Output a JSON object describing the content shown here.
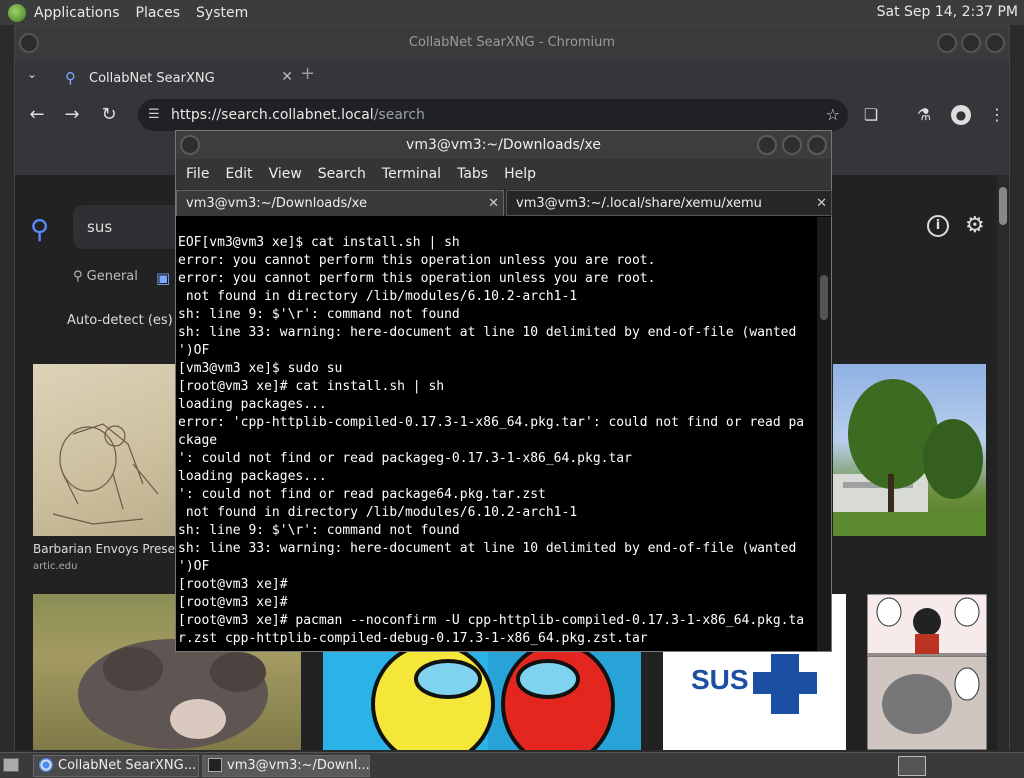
{
  "panel": {
    "menus": [
      "Applications",
      "Places",
      "System"
    ],
    "clock": "Sat Sep 14,  2:37 PM"
  },
  "chromium": {
    "title": "CollabNet SearXNG - Chromium",
    "tab_label": "CollabNet SearXNG",
    "url_host": "https://search.collabnet.local",
    "url_path": "/search",
    "search_query": "sus",
    "categories": {
      "general": "General"
    },
    "language": "Auto-detect (es)",
    "results": [
      {
        "caption": "Barbarian Envoys Prese",
        "source": "artic.edu"
      }
    ],
    "result_sus_text": "SUS"
  },
  "terminal": {
    "title": "vm3@vm3:~/Downloads/xe",
    "menus": [
      "File",
      "Edit",
      "View",
      "Search",
      "Terminal",
      "Tabs",
      "Help"
    ],
    "tabs": [
      {
        "label": "vm3@vm3:~/Downloads/xe"
      },
      {
        "label": "vm3@vm3:~/.local/share/xemu/xemu"
      }
    ],
    "lines": [
      "EOF[vm3@vm3 xe]$ cat install.sh | sh",
      "error: you cannot perform this operation unless you are root.",
      "error: you cannot perform this operation unless you are root.",
      " not found in directory /lib/modules/6.10.2-arch1-1",
      "sh: line 9: $'\\r': command not found",
      "sh: line 33: warning: here-document at line 10 delimited by end-of-file (wanted",
      "')OF",
      "[vm3@vm3 xe]$ sudo su",
      "[root@vm3 xe]# cat install.sh | sh",
      "loading packages...",
      "error: 'cpp-httplib-compiled-0.17.3-1-x86_64.pkg.tar': could not find or read pa",
      "ckage",
      "': could not find or read packageg-0.17.3-1-x86_64.pkg.tar",
      "loading packages...",
      "': could not find or read package64.pkg.tar.zst",
      " not found in directory /lib/modules/6.10.2-arch1-1",
      "sh: line 9: $'\\r': command not found",
      "sh: line 33: warning: here-document at line 10 delimited by end-of-file (wanted",
      "')OF",
      "[root@vm3 xe]#",
      "[root@vm3 xe]#",
      "[root@vm3 xe]# pacman --noconfirm -U cpp-httplib-compiled-0.17.3-1-x86_64.pkg.ta",
      "r.zst cpp-httplib-compiled-debug-0.17.3-1-x86_64.pkg.zst.tar"
    ]
  },
  "taskbar": {
    "items": [
      {
        "label": "CollabNet SearXNG..."
      },
      {
        "label": "vm3@vm3:~/Downl..."
      }
    ]
  }
}
